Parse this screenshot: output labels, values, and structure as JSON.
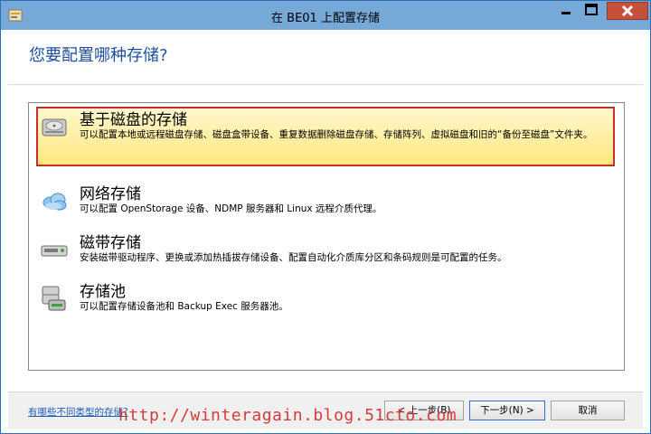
{
  "window": {
    "title": "在 BE01 上配置存储"
  },
  "page": {
    "heading": "您要配置哪种存储?"
  },
  "options": [
    {
      "title": "基于磁盘的存储",
      "description": "可以配置本地或远程磁盘存储、磁盘盒带设备、重复数据删除磁盘存储、存储阵列、虚拟磁盘和旧的“备份至磁盘”文件夹。",
      "icon": "disk-icon",
      "selected": true
    },
    {
      "title": "网络存储",
      "description": "可以配置 OpenStorage 设备、NDMP 服务器和 Linux 远程介质代理。",
      "icon": "cloud-icon",
      "selected": false
    },
    {
      "title": "磁带存储",
      "description": "安装磁带驱动程序、更换或添加热插拔存储设备、配置自动化介质库分区和条码规则是可配置的任务。",
      "icon": "tape-drive-icon",
      "selected": false
    },
    {
      "title": "存储池",
      "description": "可以配置存储设备池和 Backup Exec 服务器池。",
      "icon": "storage-pool-icon",
      "selected": false
    }
  ],
  "footer": {
    "help_link": "有哪些不同类型的存储?",
    "prev_label": "< 上一步(B)",
    "next_label": "下一步(N) >",
    "cancel_label": "取消"
  },
  "watermark": "http://winteragain.blog.51cto.com",
  "colors": {
    "titlebar": "#76a8d8",
    "heading": "#1f4e9d",
    "selection_border": "#d02b2b",
    "selection_fill": "#ffe87d",
    "close_button": "#c7503b",
    "link": "#1b5dbb"
  }
}
